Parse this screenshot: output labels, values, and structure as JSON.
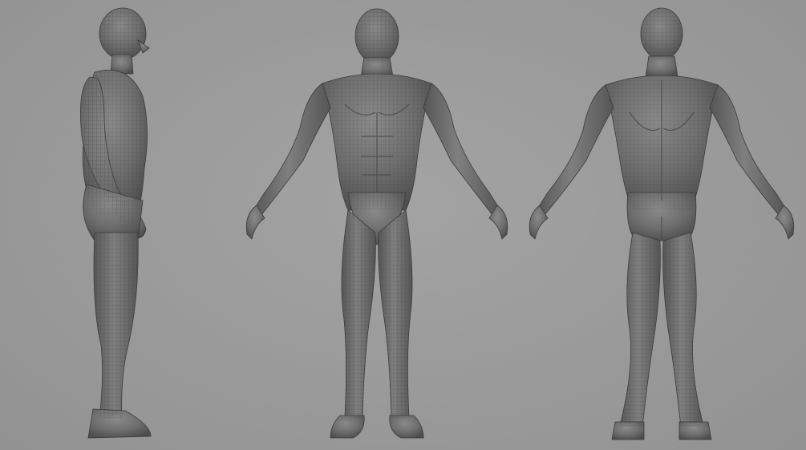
{
  "scene": {
    "background_color": "#9a9a9a",
    "model_color": "#6f6f6f",
    "wireframe_color": "#4a4a4a",
    "views": [
      {
        "id": "side",
        "description_icon": "male-body-side-view"
      },
      {
        "id": "front",
        "description_icon": "male-body-front-view"
      },
      {
        "id": "back",
        "description_icon": "male-body-back-view"
      }
    ]
  }
}
